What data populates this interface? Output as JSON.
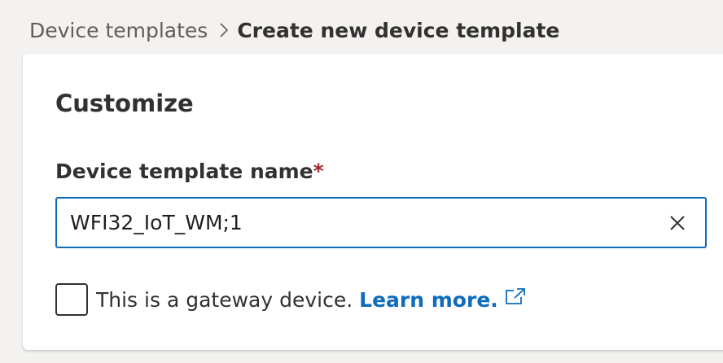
{
  "breadcrumb": {
    "parent": "Device templates",
    "current": "Create new device template"
  },
  "section": {
    "title": "Customize"
  },
  "template_name_field": {
    "label": "Device template name",
    "required_marker": "*",
    "value": "WFI32_IoT_WM;1"
  },
  "gateway_option": {
    "checked": false,
    "label": "This is a gateway device.",
    "link_text": "Learn more."
  },
  "colors": {
    "accent": "#0f6cbd",
    "required": "#a4262c",
    "background": "#f3f2f1"
  },
  "icons": {
    "breadcrumb_separator": "chevron-right-icon",
    "clear": "close-icon",
    "external_link": "external-link-icon"
  }
}
